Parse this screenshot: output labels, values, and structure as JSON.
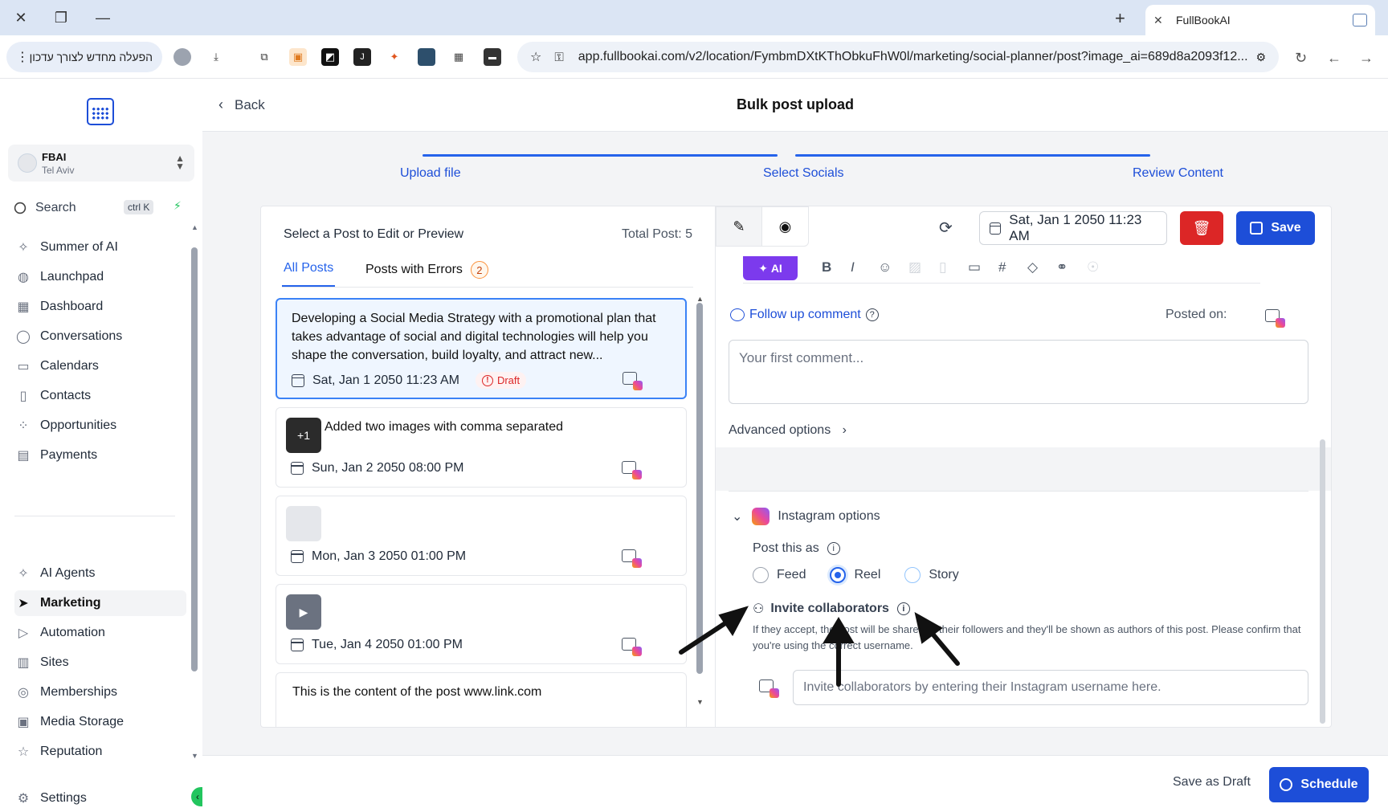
{
  "browser": {
    "tab_title": "FullBookAI",
    "new_tab": "+",
    "extension_pill": "הפעלה מחדש לצורך עדכון",
    "url": "app.fullbookai.com/v2/location/FymbmDXtKThObkuFhW0l/marketing/social-planner/post?image_ai=689d8a2093f12..."
  },
  "sidebar": {
    "location_name": "FBAI",
    "location_city": "Tel Aviv",
    "search_label": "Search",
    "search_shortcut": "ctrl K",
    "items": [
      {
        "label": "Summer of AI",
        "icon": "sparkle-icon"
      },
      {
        "label": "Launchpad",
        "icon": "rocket-icon"
      },
      {
        "label": "Dashboard",
        "icon": "grid-icon"
      },
      {
        "label": "Conversations",
        "icon": "chat-icon"
      },
      {
        "label": "Calendars",
        "icon": "calendar-icon"
      },
      {
        "label": "Contacts",
        "icon": "contacts-icon"
      },
      {
        "label": "Opportunities",
        "icon": "pipeline-icon"
      },
      {
        "label": "Payments",
        "icon": "invoice-icon"
      },
      {
        "label": "AI Agents",
        "icon": "sparkle-icon"
      },
      {
        "label": "Marketing",
        "icon": "send-icon",
        "active": true
      },
      {
        "label": "Automation",
        "icon": "play-circle-icon"
      },
      {
        "label": "Sites",
        "icon": "globe-icon"
      },
      {
        "label": "Memberships",
        "icon": "badge-icon"
      },
      {
        "label": "Media Storage",
        "icon": "image-icon"
      },
      {
        "label": "Reputation",
        "icon": "star-icon"
      },
      {
        "label": "Settings",
        "icon": "gear-icon"
      }
    ]
  },
  "header": {
    "back_label": "Back",
    "title": "Bulk post upload"
  },
  "steps": [
    "Upload file",
    "Select Socials",
    "Review Content"
  ],
  "post_list": {
    "title": "Select a Post to Edit or Preview",
    "total": "Total Post: 5",
    "tab_all": "All Posts",
    "tab_errors": "Posts with Errors",
    "error_count": "2",
    "posts": [
      {
        "text": "Developing a Social Media Strategy with a promotional plan that takes advantage of social and digital technologies will help you shape the conversation, build loyalty, and attract new...",
        "date": "Sat, Jan 1 2050 11:23 AM",
        "badge": "Draft"
      },
      {
        "text": "Added two images with comma separated",
        "date": "Sun, Jan 2 2050 08:00 PM",
        "thumb": "+1"
      },
      {
        "text": "",
        "date": "Mon, Jan 3 2050 01:00 PM"
      },
      {
        "text": "",
        "date": "Tue, Jan 4 2050 01:00 PM"
      },
      {
        "text": "This is the content of the post www.link.com",
        "date": ""
      }
    ]
  },
  "editor": {
    "schedule_date": "Sat, Jan 1 2050 11:23 AM",
    "save_label": "Save",
    "ai_label": "AI",
    "follow_up_label": "Follow up comment",
    "posted_on_label": "Posted on:",
    "comment_placeholder": "Your first comment...",
    "advanced_label": "Advanced options",
    "instagram": {
      "title": "Instagram options",
      "post_as_label": "Post this as",
      "options": [
        "Feed",
        "Reel",
        "Story"
      ],
      "selected": "Reel",
      "invite_label": "Invite collaborators",
      "invite_desc": "If they accept, the post will be shared to their followers and they'll be shown as authors of this post. Please confirm that you're using the correct username.",
      "invite_placeholder": "Invite collaborators by entering their Instagram username here."
    }
  },
  "footer": {
    "save_draft": "Save as Draft",
    "schedule": "Schedule"
  },
  "colors": {
    "primary": "#1d4ed8",
    "danger": "#dc2626",
    "ai": "#7c3aed",
    "tabbar": "#dbe5f4"
  }
}
